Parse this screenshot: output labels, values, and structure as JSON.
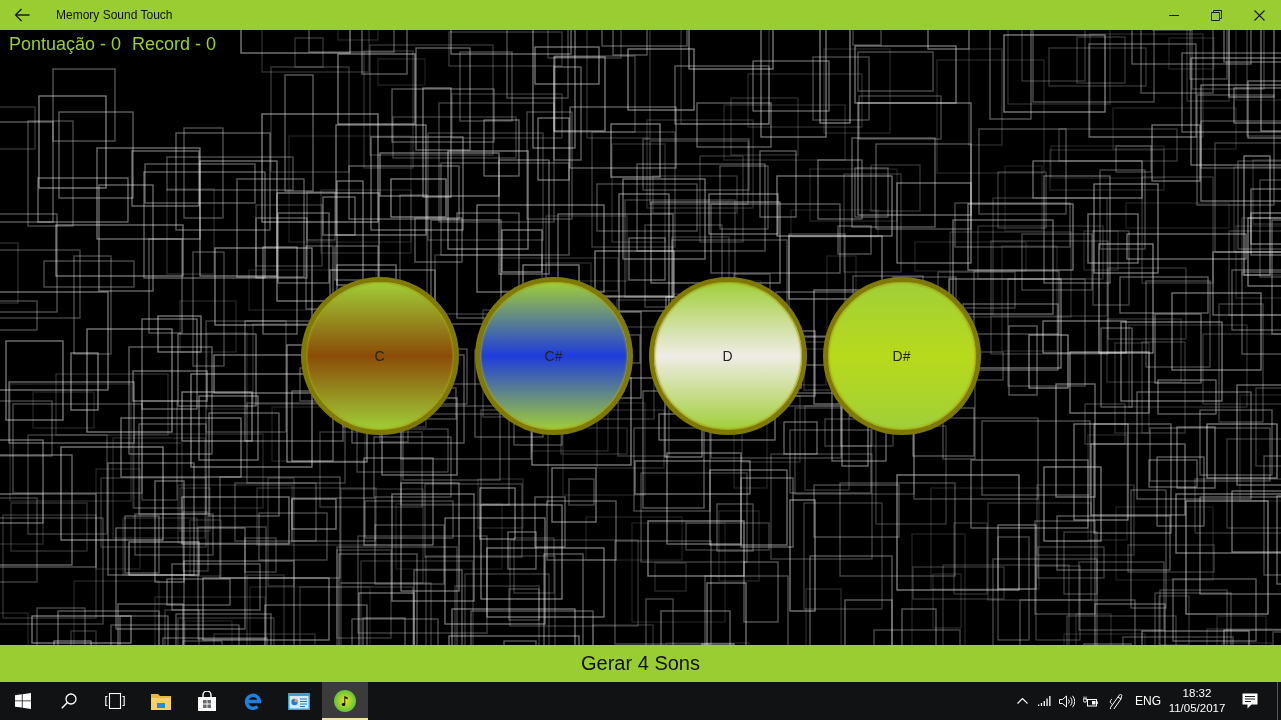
{
  "window": {
    "title": "Memory Sound Touch"
  },
  "scoreboard": {
    "score": "Pontuação - 0",
    "record": "Record - 0"
  },
  "pads": [
    {
      "label": "C",
      "color": "#8b4c08"
    },
    {
      "label": "C#",
      "color": "#1e3cdc"
    },
    {
      "label": "D",
      "color": "#f0ece6"
    },
    {
      "label": "D#",
      "color": "#b8da1c"
    }
  ],
  "action_button": {
    "label": "Gerar 4 Sons"
  },
  "taskbar": {
    "apps": [
      {
        "kind": "files",
        "selected": false
      },
      {
        "kind": "store",
        "selected": false
      },
      {
        "kind": "browser",
        "selected": false
      },
      {
        "kind": "panel",
        "selected": false
      },
      {
        "kind": "music",
        "selected": true
      }
    ],
    "tray": {
      "language": "ENG",
      "time": "18:32",
      "date": "11/05/2017"
    }
  }
}
